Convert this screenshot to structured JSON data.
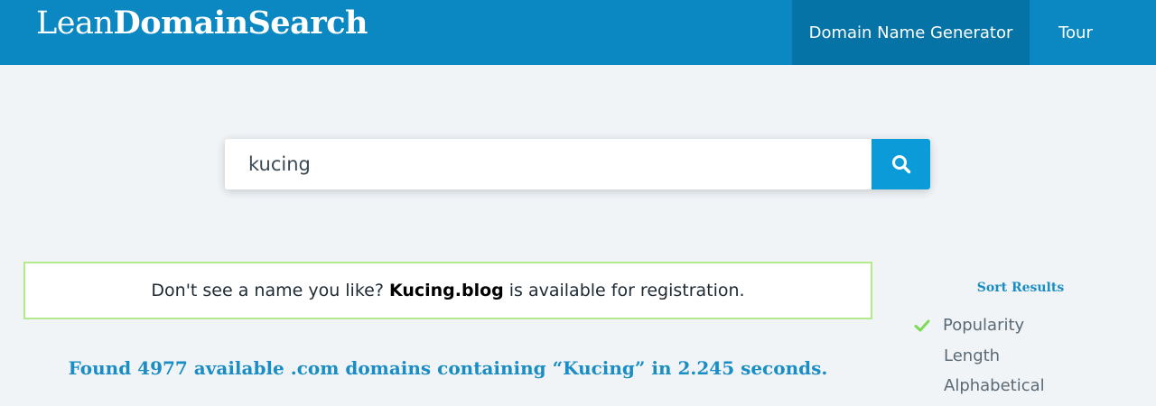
{
  "header": {
    "logo_light": "Lean",
    "logo_bold": "DomainSearch",
    "nav": [
      {
        "label": "Domain Name Generator"
      },
      {
        "label": "Tour"
      }
    ]
  },
  "search": {
    "value": "kucing",
    "icon": "search-icon"
  },
  "suggestion": {
    "prefix": "Don't see a name you like?",
    "domain": "Kucing.blog",
    "suffix": "is available for registration."
  },
  "results_summary": "Found 4977 available .com domains containing “Kucing” in 2.245 seconds.",
  "sort": {
    "title": "Sort Results",
    "options": [
      {
        "label": "Popularity",
        "selected": true
      },
      {
        "label": "Length",
        "selected": false
      },
      {
        "label": "Alphabetical",
        "selected": false
      }
    ]
  },
  "colors": {
    "header_bg": "#0b88c2",
    "nav_active_bg": "#0573a6",
    "search_button": "#0a9bd8",
    "accent_text": "#1a8dc4",
    "suggest_border": "#b5ea8c",
    "check": "#7ed957"
  }
}
